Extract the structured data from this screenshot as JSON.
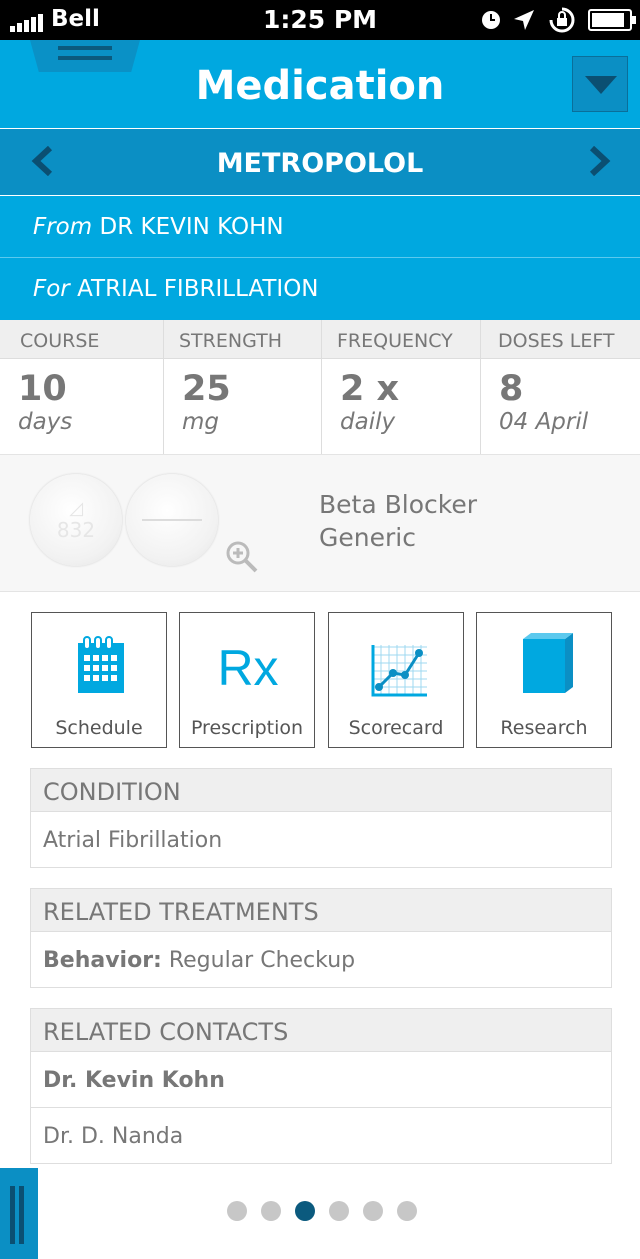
{
  "status_bar": {
    "carrier": "Bell",
    "time": "1:25 PM"
  },
  "header": {
    "title": "Medication"
  },
  "drug": {
    "name": "METROPOLOL"
  },
  "prescriber": {
    "prefix": "From",
    "name": "DR KEVIN KOHN"
  },
  "indication": {
    "prefix": "For",
    "name": "ATRIAL FIBRILLATION"
  },
  "stats": [
    {
      "label": "COURSE",
      "value": "10",
      "unit": "days"
    },
    {
      "label": "STRENGTH",
      "value": "25",
      "unit": "mg"
    },
    {
      "label": "FREQUENCY",
      "value": "2 x",
      "unit": "daily"
    },
    {
      "label": "DOSES LEFT",
      "value": "8",
      "unit": "04 April"
    }
  ],
  "pill": {
    "imprint": "832",
    "type": "Beta Blocker",
    "kind": "Generic"
  },
  "actions": [
    {
      "label": "Schedule",
      "icon": "calendar-icon"
    },
    {
      "label": "Prescription",
      "icon": "rx-icon"
    },
    {
      "label": "Scorecard",
      "icon": "chart-icon"
    },
    {
      "label": "Research",
      "icon": "book-icon"
    }
  ],
  "condition": {
    "heading": "CONDITION",
    "value": "Atrial Fibrillation"
  },
  "treatments": {
    "heading": "RELATED TREATMENTS",
    "label": "Behavior:",
    "value": "Regular Checkup"
  },
  "contacts": {
    "heading": "RELATED CONTACTS",
    "items": [
      "Dr. Kevin Kohn",
      "Dr. D. Nanda"
    ]
  },
  "pagination": {
    "total": 6,
    "active": 3
  },
  "colors": {
    "primary": "#00a8e0",
    "dark": "#0b8fc4",
    "navy": "#0b5a7e"
  }
}
